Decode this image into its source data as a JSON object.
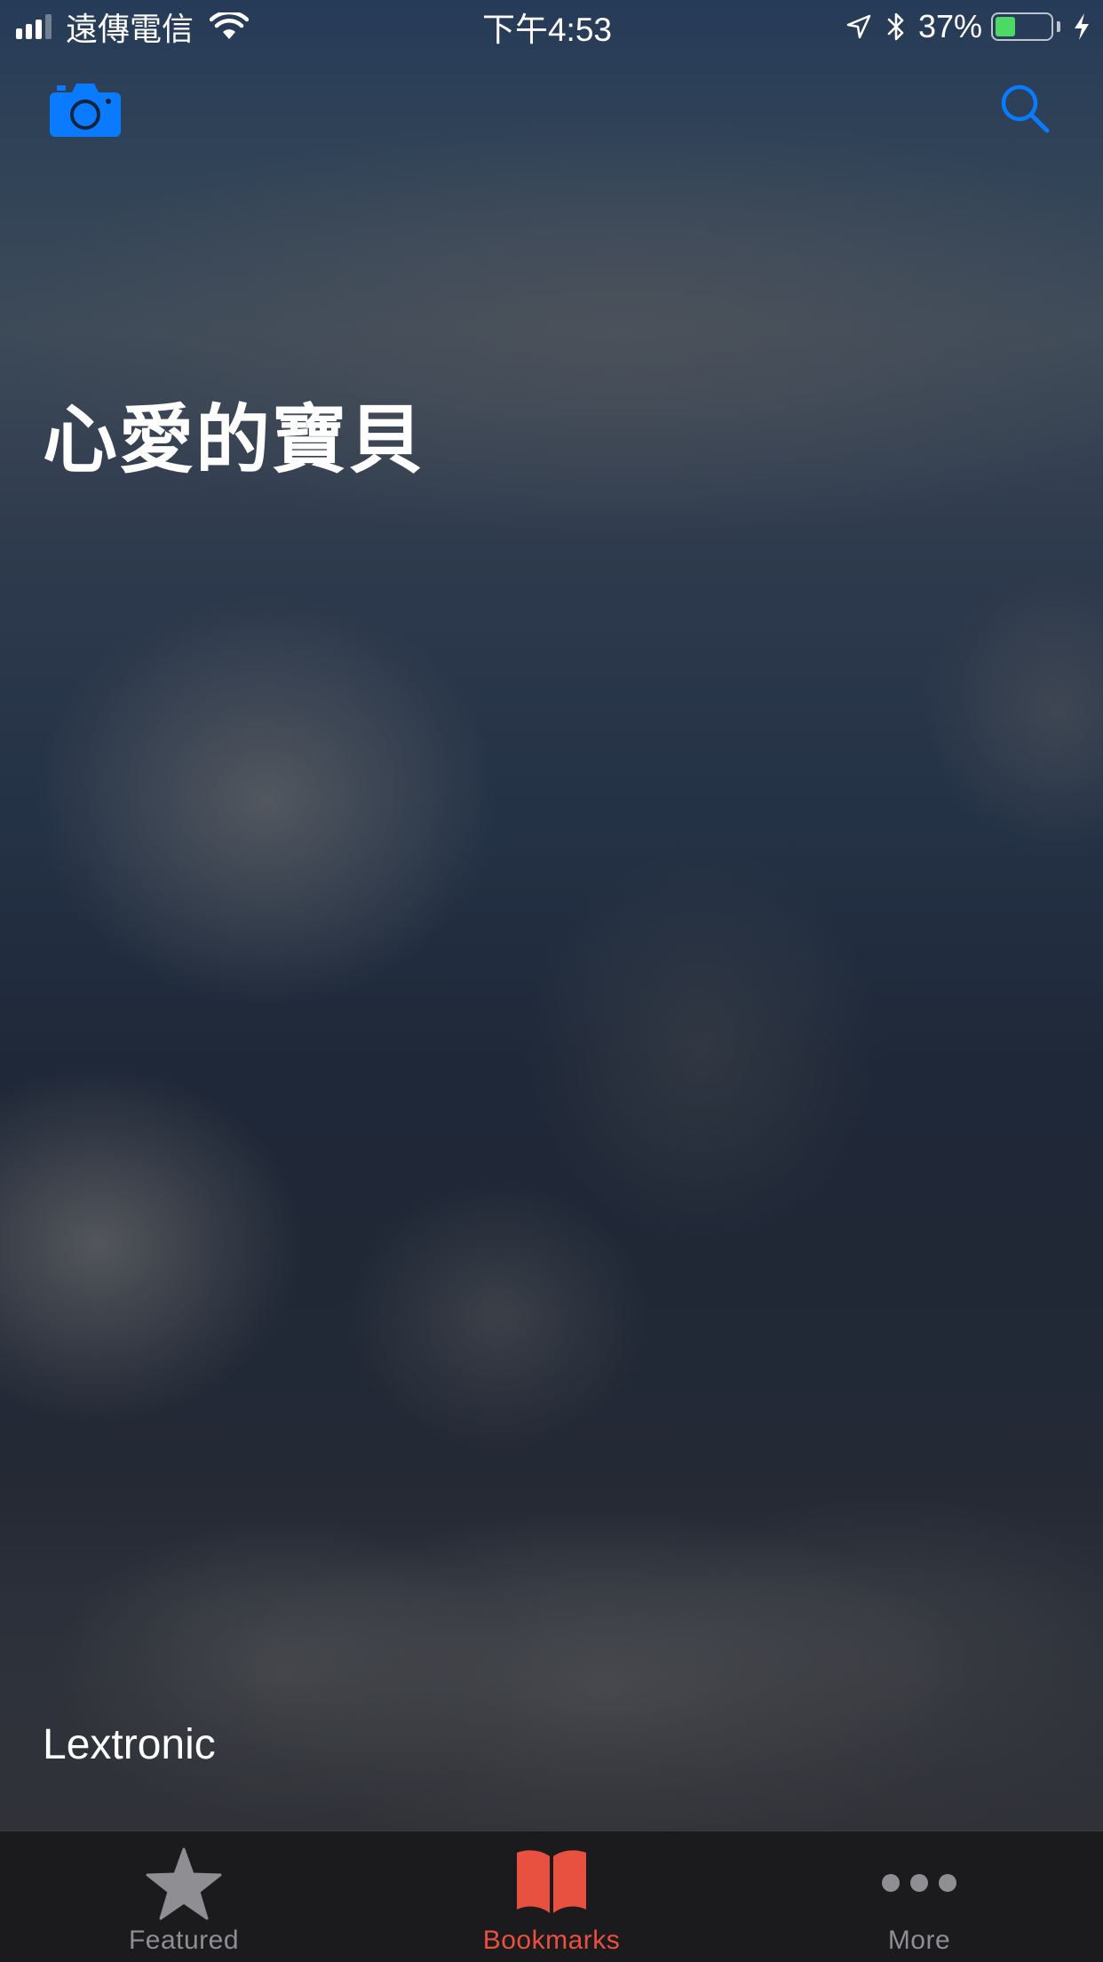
{
  "status_bar": {
    "carrier": "遠傳電信",
    "time": "下午4:53",
    "battery_percent": "37%",
    "battery_level": 0.37,
    "signal_bars_filled": 3,
    "signal_bars_total": 4,
    "icons": [
      "signal-icon",
      "wifi-icon",
      "location-arrow-icon",
      "bluetooth-icon",
      "battery-icon",
      "charging-bolt-icon"
    ]
  },
  "nav": {
    "left_icon": "camera-icon",
    "right_icon": "search-icon"
  },
  "main": {
    "title": "心愛的寶貝",
    "publisher": "Lextronic"
  },
  "tab_bar": {
    "tabs": [
      {
        "label": "Featured",
        "icon": "star-icon",
        "active": false
      },
      {
        "label": "Bookmarks",
        "icon": "open-book-icon",
        "active": true
      },
      {
        "label": "More",
        "icon": "ellipsis-icon",
        "active": false
      }
    ]
  },
  "colors": {
    "accent_blue": "#0a7aff",
    "active_tab": "#e8503f",
    "inactive_tab": "#8e8e93",
    "battery_fill": "#4cd964",
    "tab_bar_bg": "#1b1b1d"
  }
}
